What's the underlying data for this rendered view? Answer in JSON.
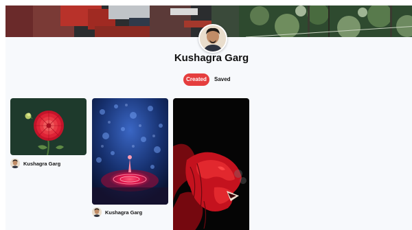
{
  "profile": {
    "name": "Kushagra Garg"
  },
  "tabs": {
    "created": "Created",
    "saved": "Saved"
  },
  "pins": [
    {
      "image": "red-dahlia-flower",
      "author": "Kushagra Garg"
    },
    {
      "image": "red-water-drop-splash",
      "author": "Kushagra Garg"
    },
    {
      "image": "red-smoke-lion",
      "author": ""
    }
  ],
  "colors": {
    "accent": "#e53e3e",
    "background": "#f7f9fc"
  }
}
